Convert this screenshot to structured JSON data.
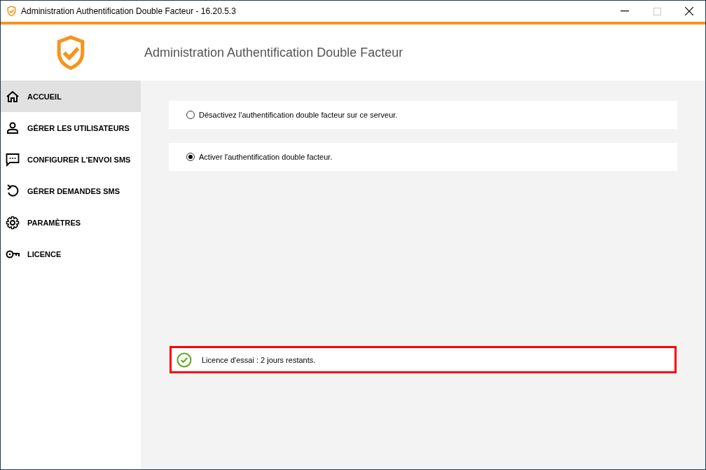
{
  "window": {
    "title": "Administration Authentification Double Facteur - 16.20.5.3",
    "maximize_disabled": true
  },
  "header": {
    "title": "Administration Authentification Double Facteur"
  },
  "sidebar": {
    "items": [
      {
        "label": "ACCUEIL",
        "selected": true
      },
      {
        "label": "GÉRER LES UTILISATEURS",
        "selected": false
      },
      {
        "label": "CONFIGURER L'ENVOI SMS",
        "selected": false
      },
      {
        "label": "GÉRER DEMANDES SMS",
        "selected": false
      },
      {
        "label": "PARAMÈTRES",
        "selected": false
      },
      {
        "label": "LICENCE",
        "selected": false
      }
    ]
  },
  "options": [
    {
      "label": "Désactivez l'authentification double facteur sur ce serveur.",
      "selected": false
    },
    {
      "label": "Activer l'authentification double facteur.",
      "selected": true
    }
  ],
  "license": {
    "text": "Licence d'essai : 2 jours restants.",
    "highlighted": true
  }
}
